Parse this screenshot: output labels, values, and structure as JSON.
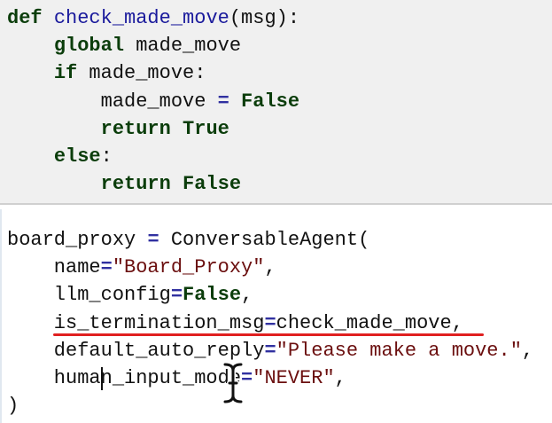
{
  "cells": [
    {
      "lines": [
        [
          [
            "kw",
            "def"
          ],
          [
            "txt",
            " "
          ],
          [
            "fn",
            "check_made_move"
          ],
          [
            "txt",
            "(msg):"
          ]
        ],
        [
          [
            "txt",
            "    "
          ],
          [
            "kw",
            "global"
          ],
          [
            "txt",
            " made_move"
          ]
        ],
        [
          [
            "txt",
            "    "
          ],
          [
            "kw",
            "if"
          ],
          [
            "txt",
            " made_move:"
          ]
        ],
        [
          [
            "txt",
            "        made_move "
          ],
          [
            "op",
            "="
          ],
          [
            "txt",
            " "
          ],
          [
            "kw",
            "False"
          ]
        ],
        [
          [
            "txt",
            "        "
          ],
          [
            "kw",
            "return"
          ],
          [
            "txt",
            " "
          ],
          [
            "kw",
            "True"
          ]
        ],
        [
          [
            "txt",
            "    "
          ],
          [
            "kw",
            "else"
          ],
          [
            "txt",
            ":"
          ]
        ],
        [
          [
            "txt",
            "        "
          ],
          [
            "kw",
            "return"
          ],
          [
            "txt",
            " "
          ],
          [
            "kw",
            "False"
          ]
        ]
      ]
    },
    {
      "lines": [
        [
          [
            "txt",
            "board_proxy "
          ],
          [
            "op",
            "="
          ],
          [
            "txt",
            " ConversableAgent("
          ]
        ],
        [
          [
            "txt",
            "    name"
          ],
          [
            "op",
            "="
          ],
          [
            "str",
            "\"Board_Proxy\""
          ],
          [
            "txt",
            ","
          ]
        ],
        [
          [
            "txt",
            "    llm_config"
          ],
          [
            "op",
            "="
          ],
          [
            "kw",
            "False"
          ],
          [
            "txt",
            ","
          ]
        ],
        [
          [
            "txt",
            "    is_termination_msg"
          ],
          [
            "op",
            "="
          ],
          [
            "txt",
            "check_made_move,"
          ]
        ],
        [
          [
            "txt",
            "    default_auto_reply"
          ],
          [
            "op",
            "="
          ],
          [
            "str",
            "\"Please make a move.\""
          ],
          [
            "txt",
            ","
          ]
        ],
        [
          [
            "txt",
            "    human_input_mode"
          ],
          [
            "op",
            "="
          ],
          [
            "str",
            "\"NEVER\""
          ],
          [
            "txt",
            ","
          ]
        ],
        [
          [
            "txt",
            ")"
          ]
        ]
      ]
    }
  ],
  "colors": {
    "keyword": "#0b3d0b",
    "function": "#1a1a9c",
    "string": "#6b0f0f",
    "underline": "#e02020"
  }
}
